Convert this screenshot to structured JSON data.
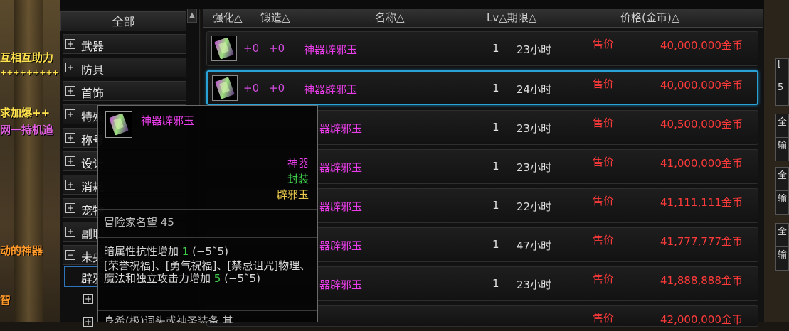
{
  "background_texts": [
    "互相互助力",
    "++++++++++",
    "求加爆++",
    "网一持机追",
    "动的神器",
    "智"
  ],
  "sidebar": {
    "all_label": "全部",
    "categories": [
      {
        "sign": "+",
        "label": "武器"
      },
      {
        "sign": "+",
        "label": "防具"
      },
      {
        "sign": "+",
        "label": "首饰"
      },
      {
        "sign": "+",
        "label": "特殊"
      },
      {
        "sign": "+",
        "label": "称号"
      },
      {
        "sign": "+",
        "label": "设计"
      },
      {
        "sign": "+",
        "label": "消耗"
      },
      {
        "sign": "+",
        "label": "宠物"
      },
      {
        "sign": "+",
        "label": "副职"
      },
      {
        "sign": "−",
        "label": "未央"
      }
    ],
    "selected_sub": "辟邪",
    "sub_sign": "+"
  },
  "table": {
    "headers": {
      "enhance": "强化△",
      "forge": "锻造△",
      "name": "名称△",
      "lv_dur": "Lv△期限△",
      "price": "价格(金币)△"
    },
    "rows": [
      {
        "enhance": "+0",
        "forge": "+0",
        "name": "神器辟邪玉",
        "lv": "1",
        "duration": "23小时",
        "sell": "售价",
        "price": "40,000,000金币"
      },
      {
        "enhance": "+0",
        "forge": "+0",
        "name": "神器辟邪玉",
        "lv": "1",
        "duration": "24小时",
        "sell": "售价",
        "price": "40,000,000金币"
      },
      {
        "enhance": "",
        "forge": "",
        "name": "器辟邪玉",
        "lv": "1",
        "duration": "23小时",
        "sell": "售价",
        "price": "40,500,000金币"
      },
      {
        "enhance": "",
        "forge": "",
        "name": "器辟邪玉",
        "lv": "1",
        "duration": "23小时",
        "sell": "售价",
        "price": "41,000,000金币"
      },
      {
        "enhance": "",
        "forge": "",
        "name": "器辟邪玉",
        "lv": "1",
        "duration": "22小时",
        "sell": "售价",
        "price": "41,111,111金币"
      },
      {
        "enhance": "",
        "forge": "",
        "name": "器辟邪玉",
        "lv": "1",
        "duration": "47小时",
        "sell": "售价",
        "price": "41,777,777金币"
      },
      {
        "enhance": "",
        "forge": "",
        "name": "器辟邪玉",
        "lv": "1",
        "duration": "23小时",
        "sell": "售价",
        "price": "41,888,888金币"
      },
      {
        "enhance": "",
        "forge": "",
        "name": "",
        "lv": "",
        "duration": "",
        "sell": "售价",
        "price": "42,000,000金币"
      }
    ],
    "selected_index": 1
  },
  "tooltip": {
    "title": "神器辟邪玉",
    "rarity": "神器",
    "bind": "封装",
    "type": "辟邪玉",
    "fame": "冒险家名望 45",
    "stat1_prefix": "暗属性抗性增加 ",
    "stat1_val": "1",
    "stat1_range": " (−5˜5)",
    "stat2_prefix": "[荣誉祝福]、[勇气祝福]、[禁忌诅咒]物理、魔法和独立攻击力增加 ",
    "stat2_val": "5",
    "stat2_range": " (−5˜5)",
    "footer": "身希(极)词头或神圣装备 其"
  },
  "right_panel": {
    "tabs": [
      "[",
      "5",
      "全",
      "输",
      "全",
      "输",
      "全",
      "输"
    ]
  },
  "colors": {
    "accent_select": "#2aa2d6",
    "item_name": "#e93de9",
    "price_red": "#ff3a3a",
    "bind_green": "#3fd04a",
    "type_gold": "#e8c84a"
  }
}
